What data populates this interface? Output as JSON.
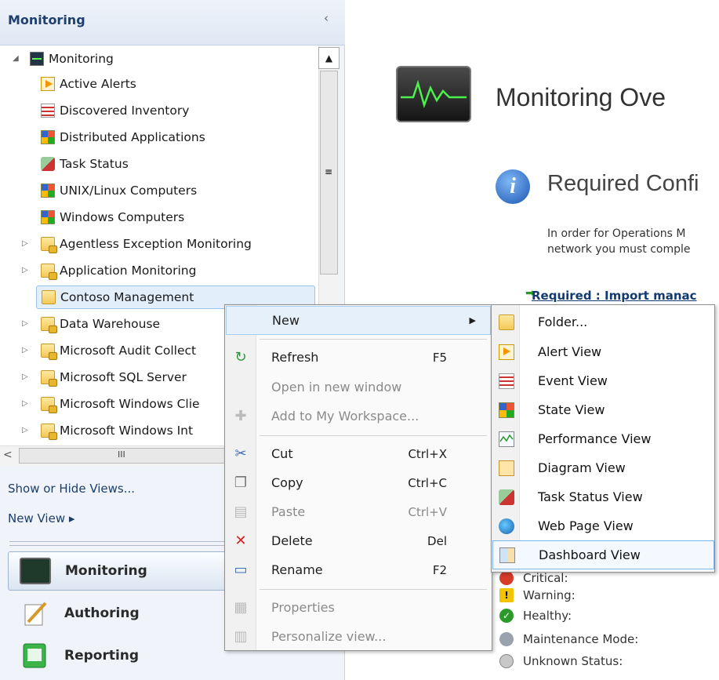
{
  "nav": {
    "title": "Monitoring",
    "collapse_glyph": "‹",
    "tree": [
      {
        "label": "Monitoring",
        "icon": "monitor-icon",
        "expander": "◢"
      },
      {
        "label": "Active Alerts",
        "icon": "alert-view-icon"
      },
      {
        "label": "Discovered Inventory",
        "icon": "list-view-icon"
      },
      {
        "label": "Distributed Applications",
        "icon": "state-view-icon"
      },
      {
        "label": "Task Status",
        "icon": "task-status-icon"
      },
      {
        "label": "UNIX/Linux Computers",
        "icon": "state-view-icon"
      },
      {
        "label": "Windows Computers",
        "icon": "state-view-icon"
      },
      {
        "label": "Agentless Exception Monitoring",
        "icon": "locked-folder-icon",
        "expander": "▷"
      },
      {
        "label": "Application Monitoring",
        "icon": "locked-folder-icon",
        "expander": "▷"
      },
      {
        "label": "Contoso Management",
        "icon": "folder-icon"
      },
      {
        "label": "Data Warehouse",
        "icon": "locked-folder-icon",
        "expander": "▷"
      },
      {
        "label": "Microsoft Audit Collect",
        "icon": "locked-folder-icon",
        "expander": "▷"
      },
      {
        "label": "Microsoft SQL Server",
        "icon": "locked-folder-icon",
        "expander": "▷"
      },
      {
        "label": "Microsoft Windows Clie",
        "icon": "locked-folder-icon",
        "expander": "▷"
      },
      {
        "label": "Microsoft Windows Int",
        "icon": "locked-folder-icon",
        "expander": "▷"
      }
    ],
    "scroll_up_glyph": "▲",
    "scroll_grip": "≡",
    "hscroll_left_glyph": "<",
    "hscroll_grip": "III",
    "links": {
      "show_hide": "Show or Hide Views...",
      "new_view": "New View ▸"
    },
    "workspaces": {
      "monitoring": "Monitoring",
      "authoring": "Authoring",
      "reporting": "Reporting"
    }
  },
  "main": {
    "title": "Monitoring Ove",
    "info_glyph": "i",
    "required_heading": "Required Confi",
    "para_line1": "In order for Operations M",
    "para_line2": "network you must comple",
    "required_link": "Required : Import manac",
    "legend": {
      "critical": "Critical:",
      "warning": "Warning:",
      "healthy": "Healthy:",
      "maintenance": "Maintenance Mode:",
      "unknown": "Unknown Status:"
    }
  },
  "context_menu": {
    "new": "New",
    "submenu_arrow": "▶",
    "refresh": {
      "label": "Refresh",
      "shortcut": "F5"
    },
    "open_new_window": "Open in new window",
    "add_workspace": "Add to My Workspace...",
    "cut": {
      "label": "Cut",
      "shortcut": "Ctrl+X"
    },
    "copy": {
      "label": "Copy",
      "shortcut": "Ctrl+C"
    },
    "paste": {
      "label": "Paste",
      "shortcut": "Ctrl+V"
    },
    "delete": {
      "label": "Delete",
      "shortcut": "Del"
    },
    "rename": {
      "label": "Rename",
      "shortcut": "F2"
    },
    "properties": "Properties",
    "personalize": "Personalize view..."
  },
  "submenu": {
    "folder": "Folder...",
    "alert_view": "Alert View",
    "event_view": "Event View",
    "state_view": "State View",
    "performance_view": "Performance View",
    "diagram_view": "Diagram View",
    "task_status_view": "Task Status View",
    "web_page_view": "Web Page View",
    "dashboard_view": "Dashboard View"
  },
  "colors": {
    "accent": "#1c3d6a",
    "highlight": "#e5f0fb",
    "critical": "#d63b2a",
    "warning": "#f2c400",
    "healthy": "#2b9a2b"
  }
}
